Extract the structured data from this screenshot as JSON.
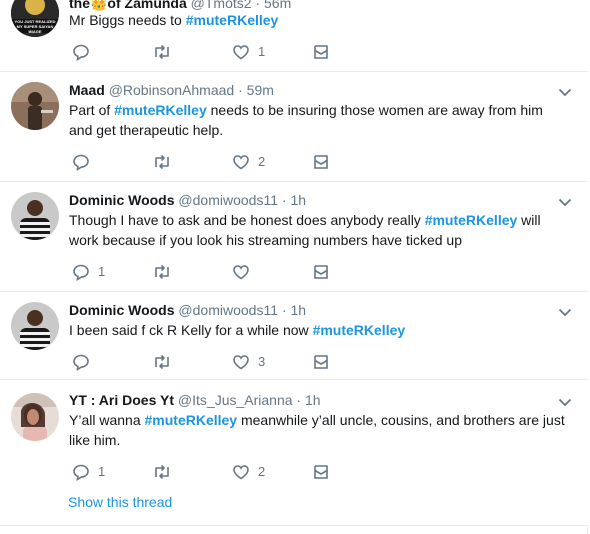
{
  "tweets": [
    {
      "name": "the👑of Zamunda",
      "handle": "@Tmots2",
      "time": "56m",
      "text_before": "Mr Biggs needs to ",
      "hashtag": "#muteRKelley",
      "text_after": "",
      "reply_count": "",
      "retweet_count": "",
      "like_count": "1"
    },
    {
      "name": "Maad",
      "handle": "@RobinsonAhmaad",
      "time": "59m",
      "text_before": "Part of  ",
      "hashtag": "#muteRKelley",
      "text_after": " needs to be insuring those women are away from him and get therapeutic help.",
      "reply_count": "",
      "retweet_count": "",
      "like_count": "2"
    },
    {
      "name": "Dominic Woods",
      "handle": "@domiwoods11",
      "time": "1h",
      "text_before": "Though I have to ask and be honest does anybody really ",
      "hashtag": "#muteRKelley",
      "text_after": " will work because if you look his streaming numbers have ticked up",
      "reply_count": "1",
      "retweet_count": "",
      "like_count": ""
    },
    {
      "name": "Dominic Woods",
      "handle": "@domiwoods11",
      "time": "1h",
      "text_before": "I been said f  ck R Kelly for a while now  ",
      "hashtag": "#muteRKelley",
      "text_after": "",
      "reply_count": "",
      "retweet_count": "",
      "like_count": "3"
    },
    {
      "name": "YT : Ari Does Yt",
      "handle": "@Its_Jus_Arianna",
      "time": "1h",
      "text_before": "Y’all wanna ",
      "hashtag": "#muteRKelley",
      "text_after": " meanwhile y’all uncle, cousins, and brothers are just like him.",
      "reply_count": "1",
      "retweet_count": "",
      "like_count": "2",
      "show_thread": "Show this thread"
    }
  ],
  "avatar_badges": {
    "t0": "YOU JUST REALIZED MY SUPER SAIYAN IMAGE"
  },
  "separator": " · ",
  "colors": {
    "link": "#1b95e0",
    "secondary": "#657786",
    "border": "#e6ecf0",
    "primary_text": "#14171a"
  },
  "icons": [
    "reply-icon",
    "retweet-icon",
    "like-icon",
    "direct-message-icon",
    "caret-down-icon"
  ]
}
